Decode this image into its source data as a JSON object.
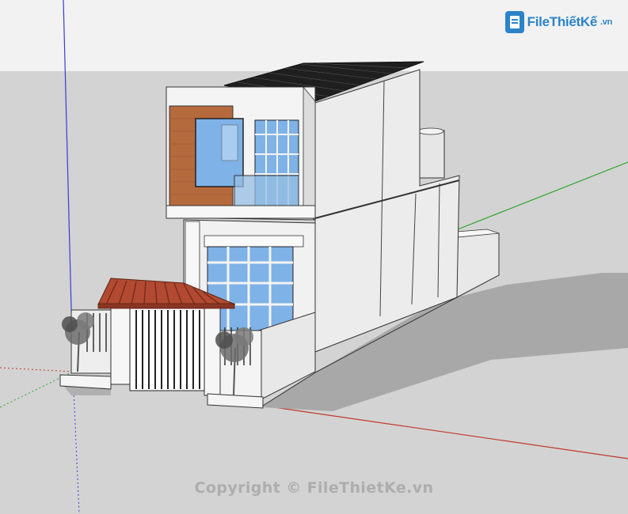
{
  "logo": {
    "text": "FileThiếtKế",
    "suffix": ".vn"
  },
  "watermark": {
    "text": "Copyright © FileThietKe.vn"
  },
  "colors": {
    "sky": "#f2f2f2",
    "ground": "#d3d3d3",
    "axis_red": "#c0392b",
    "axis_green": "#2ea52e",
    "axis_blue": "#3b3bd6",
    "brick": "#b56a3e",
    "roof_tile": "#b24a32",
    "glass": "#7fb2e6",
    "roof": "#1f1f1f",
    "logo_blue": "#2b84c9"
  }
}
